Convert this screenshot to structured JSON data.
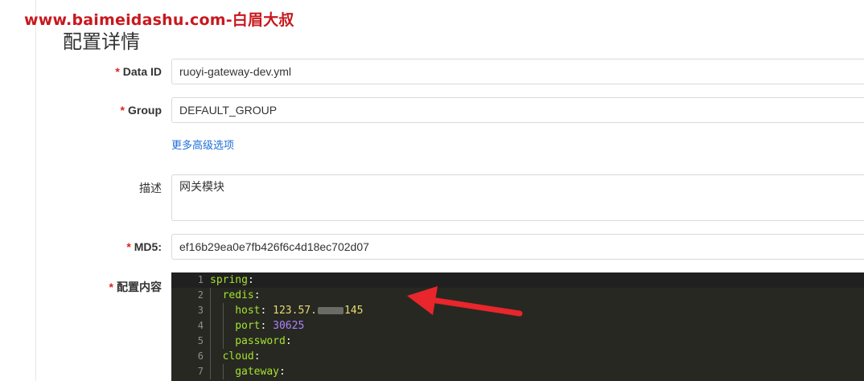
{
  "watermark": "www.baimeidashu.com-白眉大叔",
  "page_title": "配置详情",
  "form": {
    "data_id": {
      "required": "*",
      "label": "Data ID",
      "value": "ruoyi-gateway-dev.yml"
    },
    "group": {
      "required": "*",
      "label": "Group",
      "value": "DEFAULT_GROUP"
    },
    "advanced_link": "更多高级选项",
    "description": {
      "label": "描述",
      "value": "网关模块"
    },
    "md5": {
      "required": "*",
      "label": "MD5:",
      "value": "ef16b29ea0e7fb426f6c4d18ec702d07"
    },
    "content": {
      "required": "*",
      "label": "配置内容"
    }
  },
  "editor": {
    "lines": [
      {
        "num": "1",
        "key": "spring",
        "sep": ":",
        "val": ""
      },
      {
        "num": "2",
        "key": "redis",
        "sep": ":",
        "val": ""
      },
      {
        "num": "3",
        "key": "host",
        "sep": ": ",
        "val_pre": "123.57.",
        "val_post": "145"
      },
      {
        "num": "4",
        "key": "port",
        "sep": ": ",
        "val": "30625"
      },
      {
        "num": "5",
        "key": "password",
        "sep": ":",
        "val": ""
      },
      {
        "num": "6",
        "key": "cloud",
        "sep": ":",
        "val": ""
      },
      {
        "num": "7",
        "key": "gateway",
        "sep": ":",
        "val": ""
      }
    ]
  },
  "colors": {
    "required_star": "#e02020",
    "link": "#1e6fd9",
    "editor_bg": "#272822",
    "annotation_arrow": "#e8262b",
    "watermark": "#c8181e"
  }
}
